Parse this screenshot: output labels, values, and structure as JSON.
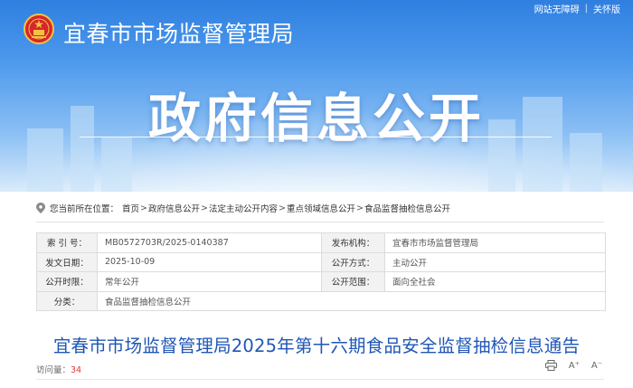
{
  "header": {
    "site_name": "宜春市市场监督管理局",
    "page_title": "政府信息公开",
    "top_links": [
      "网站无障碍",
      "关怀版"
    ]
  },
  "breadcrumb": {
    "prefix": "您当前所在位置：",
    "items": [
      "首页",
      "政府信息公开",
      "法定主动公开内容",
      "重点领域信息公开",
      "食品监督抽检信息公开"
    ],
    "separator": ">"
  },
  "meta": {
    "index_label": "索 引 号：",
    "index_value": "MB0572703R/2025-0140387",
    "publisher_label": "发布机构：",
    "publisher_value": "宜春市市场监督管理局",
    "date_label": "发文日期：",
    "date_value": "2025-10-09",
    "mode_label": "公开方式：",
    "mode_value": "主动公开",
    "time_label": "公开时限：",
    "time_value": "常年公开",
    "scope_label": "公开范围：",
    "scope_value": "面向全社会",
    "category_label": "分类：",
    "category_value": "食品监督抽检信息公开"
  },
  "article": {
    "title": "宜春市市场监督管理局2025年第十六期食品安全监督抽检信息通告",
    "visits_label": "访问量：",
    "visits_count": "34",
    "font_increase": "A⁺",
    "font_decrease": "A⁻"
  },
  "colors": {
    "banner_blue": "#2f7fe0",
    "title_blue": "#1f56b5",
    "visit_red": "#e4393c"
  }
}
